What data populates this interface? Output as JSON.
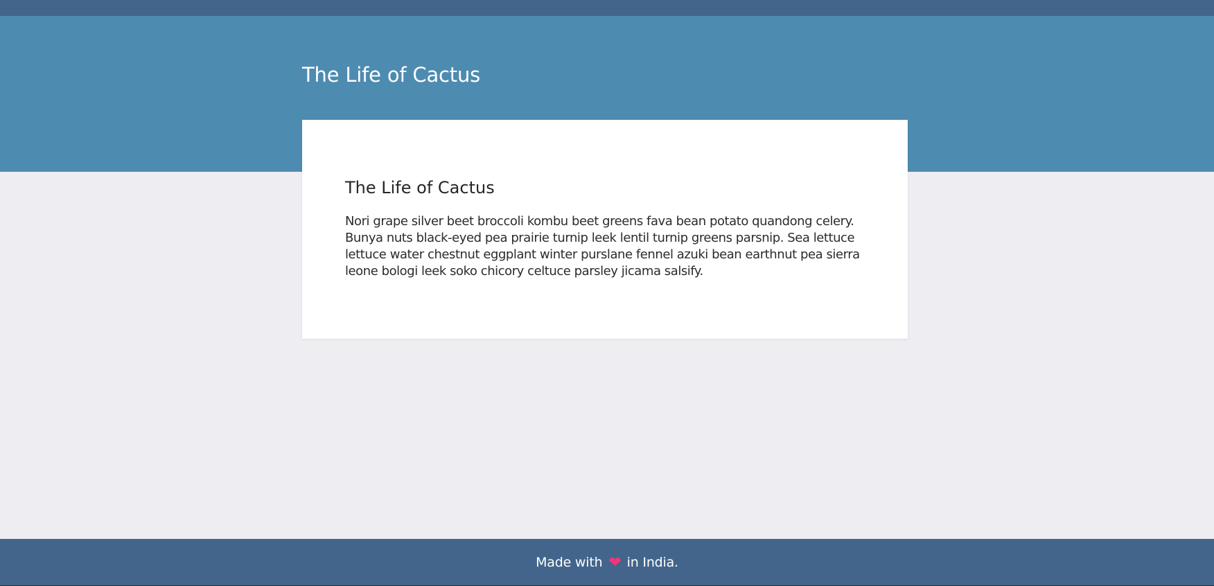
{
  "header": {
    "site_title": "The Life of Cactus"
  },
  "card": {
    "title": "The Life of Cactus",
    "body": "Nori grape silver beet broccoli kombu beet greens fava bean potato quandong celery. Bunya nuts black-eyed pea prairie turnip leek lentil turnip greens parsnip. Sea lettuce lettuce water chestnut eggplant winter purslane fennel azuki bean earthnut pea sierra leone bologi leek soko chicory celtuce parsley jicama salsify."
  },
  "footer": {
    "text_before": "Made with",
    "heart_icon": "heart-icon",
    "text_after": "in India."
  },
  "colors": {
    "top_bar": "#43658b",
    "hero": "#4e8bb1",
    "page_background": "#eeedf2",
    "card_background": "#ffffff",
    "footer": "#43658b",
    "heart": "#f0357b"
  }
}
